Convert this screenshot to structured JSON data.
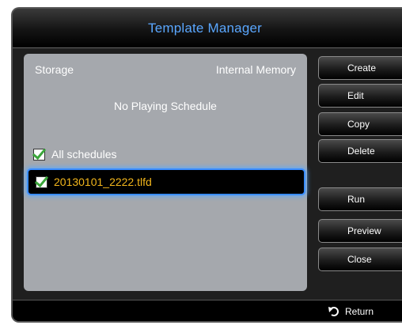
{
  "window": {
    "title": "Template Manager"
  },
  "storage": {
    "label": "Storage",
    "value": "Internal Memory"
  },
  "status": {
    "message": "No Playing Schedule"
  },
  "list": {
    "all_label": "All schedules",
    "items": [
      {
        "name": "20130101_2222.tlfd",
        "checked": true
      }
    ]
  },
  "buttons": {
    "create": "Create",
    "edit": "Edit",
    "copy": "Copy",
    "delete": "Delete",
    "run": "Run",
    "preview": "Preview",
    "close": "Close"
  },
  "footer": {
    "return_label": "Return",
    "return_icon": "return-arrow-icon"
  },
  "colors": {
    "title": "#5aa7ff",
    "file_text": "#f2b61c",
    "focus_ring": "#3a8dff",
    "check": "#3aa63a"
  }
}
